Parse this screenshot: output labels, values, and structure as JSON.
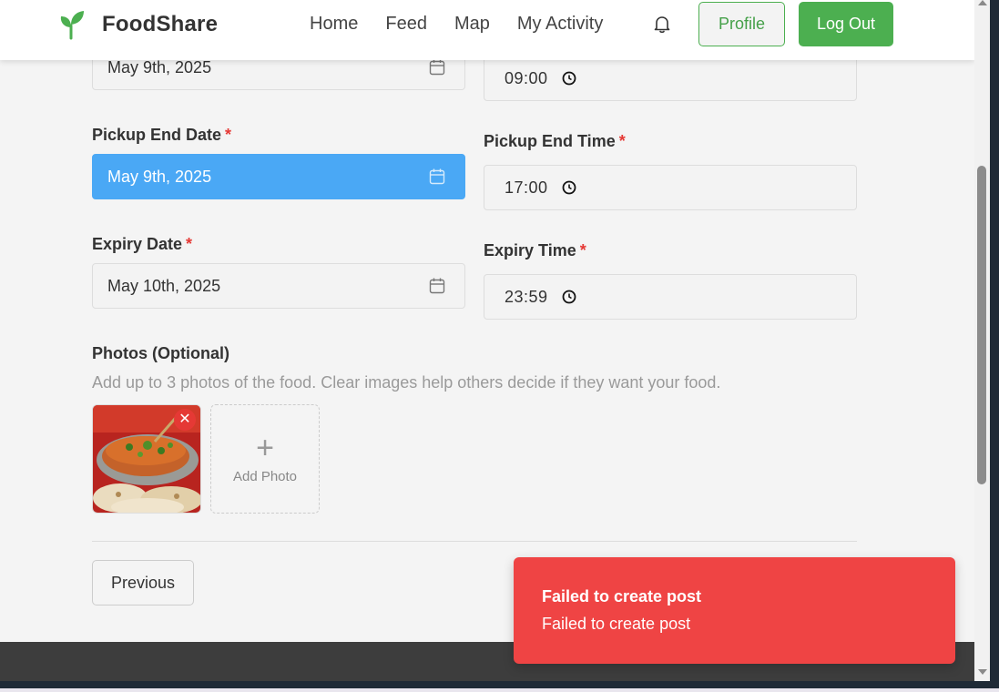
{
  "header": {
    "brand": "FoodShare",
    "nav": [
      "Home",
      "Feed",
      "Map",
      "My Activity"
    ],
    "profile_label": "Profile",
    "logout_label": "Log Out",
    "brand_color": "#4caf50"
  },
  "form": {
    "pickup_start_date_value": "May 9th, 2025",
    "pickup_start_time_value": "09:00",
    "pickup_end_date": {
      "label": "Pickup End Date",
      "value": "May 9th, 2025"
    },
    "pickup_end_time": {
      "label": "Pickup End Time",
      "value": "17:00"
    },
    "expiry_date": {
      "label": "Expiry Date",
      "value": "May 10th, 2025"
    },
    "expiry_time": {
      "label": "Expiry Time",
      "value": "23:59"
    },
    "required_marker": "*",
    "active_field_color": "#4aa8f5"
  },
  "photos": {
    "title": "Photos (Optional)",
    "help": "Add up to 3 photos of the food. Clear images help others decide if they want your food.",
    "add_label": "Add Photo",
    "remove_symbol": "✕",
    "add_symbol": "+"
  },
  "actions": {
    "previous_label": "Previous"
  },
  "toast": {
    "title": "Failed to create post",
    "message": "Failed to create post",
    "color": "#ef4444"
  }
}
